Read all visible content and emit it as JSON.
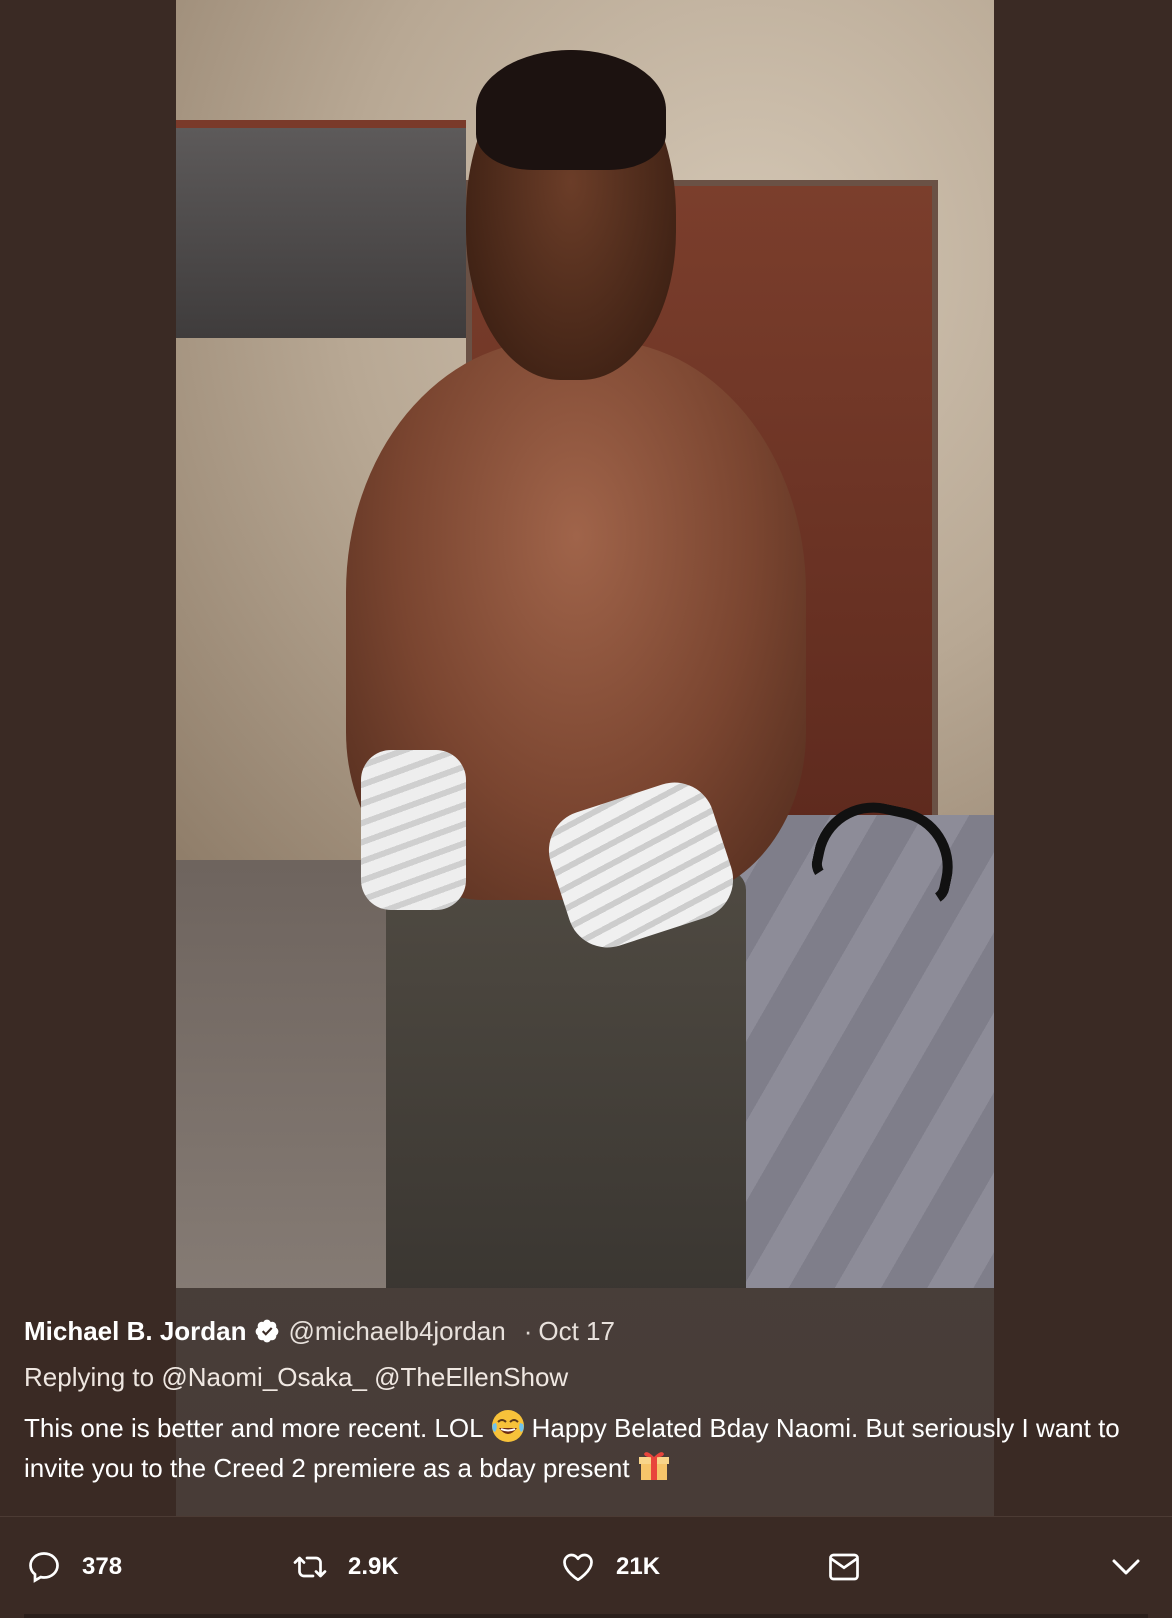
{
  "tweet": {
    "author_name": "Michael B. Jordan",
    "handle": "@michaelb4jordan",
    "separator": "·",
    "timestamp": "Oct 17",
    "replying_prefix": "Replying to",
    "reply_mentions": [
      "@Naomi_Osaka_",
      "@TheEllenShow"
    ],
    "text_part1": "This one is better and more recent. LOL",
    "text_part2": "Happy Belated Bday Naomi. But seriously I want to invite you to the Creed 2 premiere as a bday present",
    "emoji_1": "face-with-tears-of-joy-icon",
    "emoji_2": "wrapped-gift-icon",
    "verified_icon": "verified-badge-icon"
  },
  "actions": {
    "reply_count": "378",
    "retweet_count": "2.9K",
    "like_count": "21K",
    "reply_icon": "speech-bubble-icon",
    "retweet_icon": "retweet-icon",
    "like_icon": "heart-icon",
    "message_icon": "envelope-icon",
    "more_icon": "chevron-down-icon"
  },
  "colors": {
    "background": "#3a2a24",
    "text": "#ffffff",
    "verified_badge": "#ffffff"
  }
}
